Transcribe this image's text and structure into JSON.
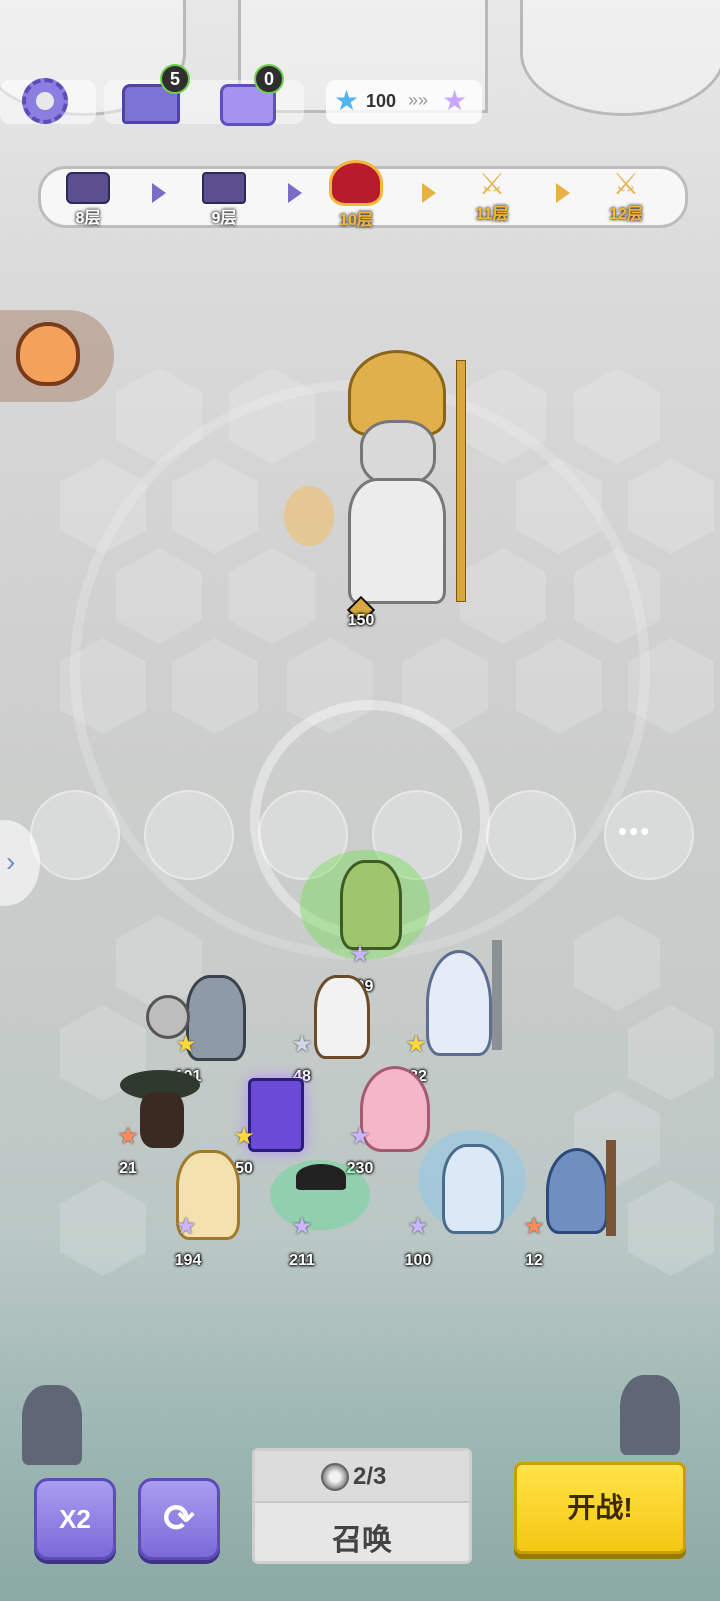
{
  "top_bar": {
    "settings_icon": "gear-icon",
    "anvil_count": "5",
    "chest_count": "0",
    "stars_value": "100"
  },
  "floors": [
    {
      "label": "8层",
      "icon": "treasure-chest-icon",
      "state": "done"
    },
    {
      "label": "9层",
      "icon": "anvil-icon",
      "state": "done"
    },
    {
      "label": "10层",
      "icon": "demon-helmet-icon",
      "state": "current"
    },
    {
      "label": "11层",
      "icon": "crossed-swords-icon",
      "state": "upcoming"
    },
    {
      "label": "12层",
      "icon": "crossed-swords-icon",
      "state": "upcoming"
    }
  ],
  "boss": {
    "level": "150",
    "name_icon": "athena-statue"
  },
  "bench": {
    "more_label": "•••"
  },
  "units": [
    {
      "level": "209",
      "star_color": "#c9b6ff"
    },
    {
      "level": "101",
      "star_color": "#ffd93b"
    },
    {
      "level": "48",
      "star_color": "#cfd8ea"
    },
    {
      "level": "82",
      "star_color": "#ffd93b"
    },
    {
      "level": "21",
      "star_color": "#ff8a5c"
    },
    {
      "level": "50",
      "star_color": "#ffd93b"
    },
    {
      "level": "230",
      "star_color": "#c9b6ff"
    },
    {
      "level": "194",
      "star_color": "#c9b6ff"
    },
    {
      "level": "211",
      "star_color": "#c9b6ff"
    },
    {
      "level": "100",
      "star_color": "#c9b6ff"
    },
    {
      "level": "12",
      "star_color": "#ff8a5c"
    }
  ],
  "buttons": {
    "speed": "X2",
    "summon_cost": "2/3",
    "summon": "召唤",
    "fight": "开战!"
  }
}
